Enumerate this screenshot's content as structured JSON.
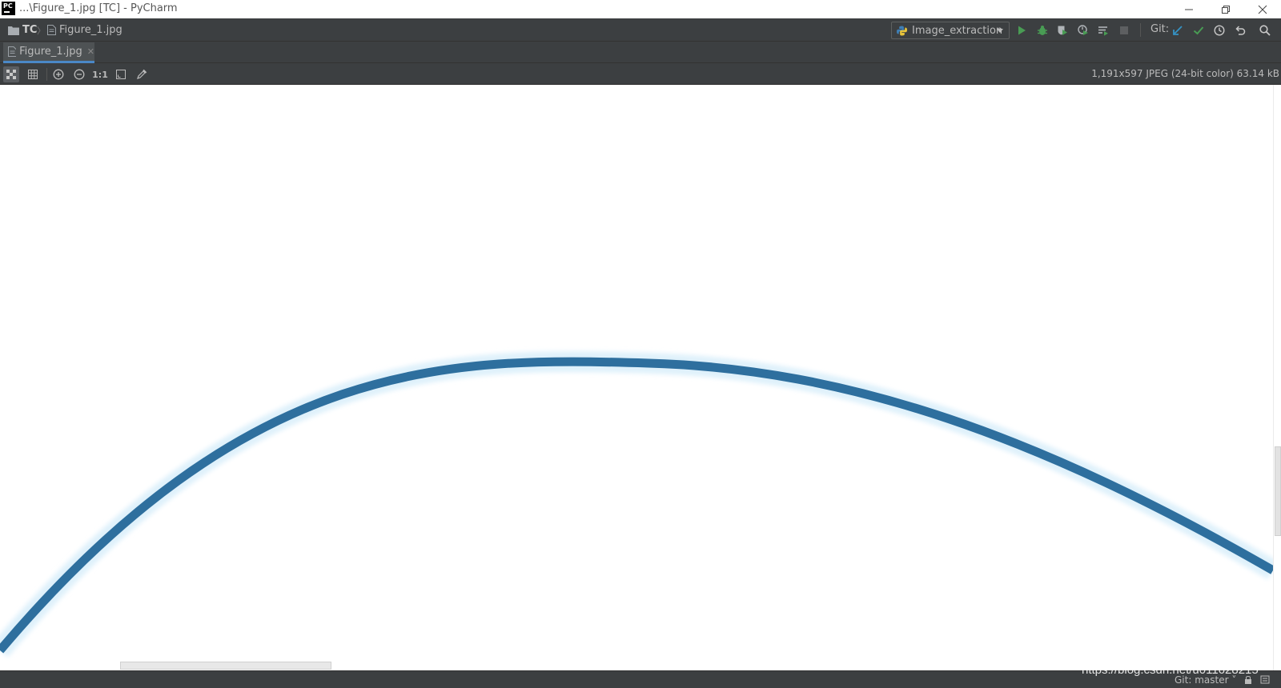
{
  "window": {
    "title": "...\\Figure_1.jpg [TC] - PyCharm",
    "logo_text": "PC"
  },
  "navbar": {
    "project": "TC",
    "file": "Figure_1.jpg",
    "run_config": "Image_extraction",
    "git_label": "Git:"
  },
  "tabs": [
    {
      "label": "Figure_1.jpg",
      "active": true
    }
  ],
  "image_toolbar": {
    "actual_size_label": "1:1",
    "info": "1,191x597 JPEG (24-bit color) 63.14 kB"
  },
  "status": {
    "git_branch": "Git: master ˅"
  },
  "watermark": "https://blog.csdn.net/u011628215",
  "colors": {
    "curve": "#2e6f9e",
    "accent": "#4a88c7",
    "run_green": "#499c54",
    "git_blue": "#3592c4"
  }
}
